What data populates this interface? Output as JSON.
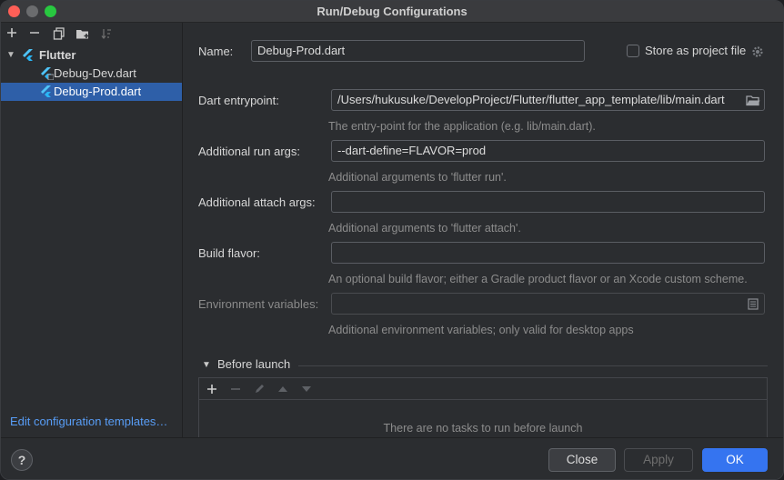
{
  "window": {
    "title": "Run/Debug Configurations"
  },
  "left_panel": {
    "tree": {
      "group_label": "Flutter",
      "items": [
        {
          "label": "Debug-Dev.dart",
          "selected": false
        },
        {
          "label": "Debug-Prod.dart",
          "selected": true
        }
      ]
    },
    "edit_templates_link": "Edit configuration templates…"
  },
  "form": {
    "name_label": "Name:",
    "name_value": "Debug-Prod.dart",
    "store_label": "Store as project file",
    "store_checked": false,
    "entrypoint_label": "Dart entrypoint:",
    "entrypoint_value": "/Users/hukusuke/DevelopProject/Flutter/flutter_app_template/lib/main.dart",
    "entrypoint_hint": "The entry-point for the application (e.g. lib/main.dart).",
    "run_args_label": "Additional run args:",
    "run_args_value": "--dart-define=FLAVOR=prod",
    "run_args_hint": "Additional arguments to 'flutter run'.",
    "attach_args_label": "Additional attach args:",
    "attach_args_value": "",
    "attach_args_hint": "Additional arguments to 'flutter attach'.",
    "build_flavor_label": "Build flavor:",
    "build_flavor_value": "",
    "build_flavor_hint": "An optional build flavor; either a Gradle product flavor or an Xcode custom scheme.",
    "env_label": "Environment variables:",
    "env_value": "",
    "env_hint": "Additional environment variables; only valid for desktop apps"
  },
  "before_launch": {
    "title": "Before launch",
    "empty_text": "There are no tasks to run before launch"
  },
  "footer": {
    "help": "?",
    "close": "Close",
    "apply": "Apply",
    "ok": "OK"
  },
  "colors": {
    "accent": "#3574f0",
    "selection": "#2e5fa8",
    "link": "#589df6"
  }
}
